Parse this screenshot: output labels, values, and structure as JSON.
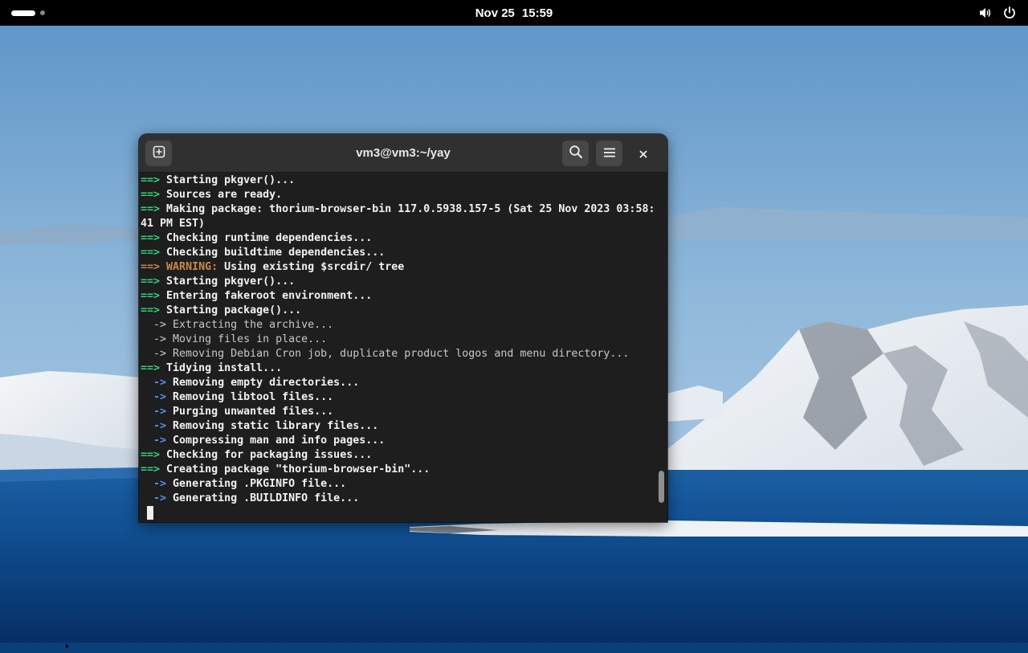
{
  "topbar": {
    "date": "Nov 25",
    "time": "15:59",
    "icons": {
      "volume": "volume-icon",
      "power": "power-icon",
      "activities": "activities-indicator"
    }
  },
  "terminal": {
    "title": "vm3@vm3:~/yay",
    "buttons": {
      "new_tab": "new-tab-icon",
      "search": "search-icon",
      "menu": "hamburger-menu-icon",
      "close": "close-icon"
    },
    "lines": [
      {
        "prefix": "==>",
        "kind": "main",
        "text": "Starting pkgver()..."
      },
      {
        "prefix": "==>",
        "kind": "main",
        "text": "Sources are ready."
      },
      {
        "prefix": "==>",
        "kind": "main",
        "text": "Making package: thorium-browser-bin 117.0.5938.157-5 (Sat 25 Nov 2023 03:58:"
      },
      {
        "prefix": "",
        "kind": "cont",
        "text": "41 PM EST)"
      },
      {
        "prefix": "==>",
        "kind": "main",
        "text": "Checking runtime dependencies..."
      },
      {
        "prefix": "==>",
        "kind": "main",
        "text": "Checking buildtime dependencies..."
      },
      {
        "prefix": "==>",
        "kind": "warn",
        "warn": "WARNING:",
        "text": "Using existing $srcdir/ tree"
      },
      {
        "prefix": "==>",
        "kind": "main",
        "text": "Starting pkgver()..."
      },
      {
        "prefix": "==>",
        "kind": "main",
        "text": "Entering fakeroot environment..."
      },
      {
        "prefix": "==>",
        "kind": "main",
        "text": "Starting package()..."
      },
      {
        "prefix": "  ->",
        "kind": "plain",
        "text": "Extracting the archive..."
      },
      {
        "prefix": "  ->",
        "kind": "plain",
        "text": "Moving files in place..."
      },
      {
        "prefix": "  ->",
        "kind": "plain",
        "text": "Removing Debian Cron job, duplicate product logos and menu directory..."
      },
      {
        "prefix": "==>",
        "kind": "main",
        "text": "Tidying install..."
      },
      {
        "prefix": "  ->",
        "kind": "sub",
        "text": "Removing empty directories..."
      },
      {
        "prefix": "  ->",
        "kind": "sub",
        "text": "Removing libtool files..."
      },
      {
        "prefix": "  ->",
        "kind": "sub",
        "text": "Purging unwanted files..."
      },
      {
        "prefix": "  ->",
        "kind": "sub",
        "text": "Removing static library files..."
      },
      {
        "prefix": "  ->",
        "kind": "sub",
        "text": "Compressing man and info pages..."
      },
      {
        "prefix": "==>",
        "kind": "main",
        "text": "Checking for packaging issues..."
      },
      {
        "prefix": "==>",
        "kind": "main",
        "text": "Creating package \"thorium-browser-bin\"..."
      },
      {
        "prefix": "  ->",
        "kind": "sub",
        "text": "Generating .PKGINFO file..."
      },
      {
        "prefix": "  ->",
        "kind": "sub",
        "text": "Generating .BUILDINFO file..."
      }
    ],
    "scroll_position": 0.95
  },
  "colors": {
    "arrow_main": "#33d17a",
    "warning": "#c88a4a",
    "arrow_sub": "#5294e2",
    "terminal_bg": "#1e1e1e",
    "headerbar_bg": "#303030"
  }
}
